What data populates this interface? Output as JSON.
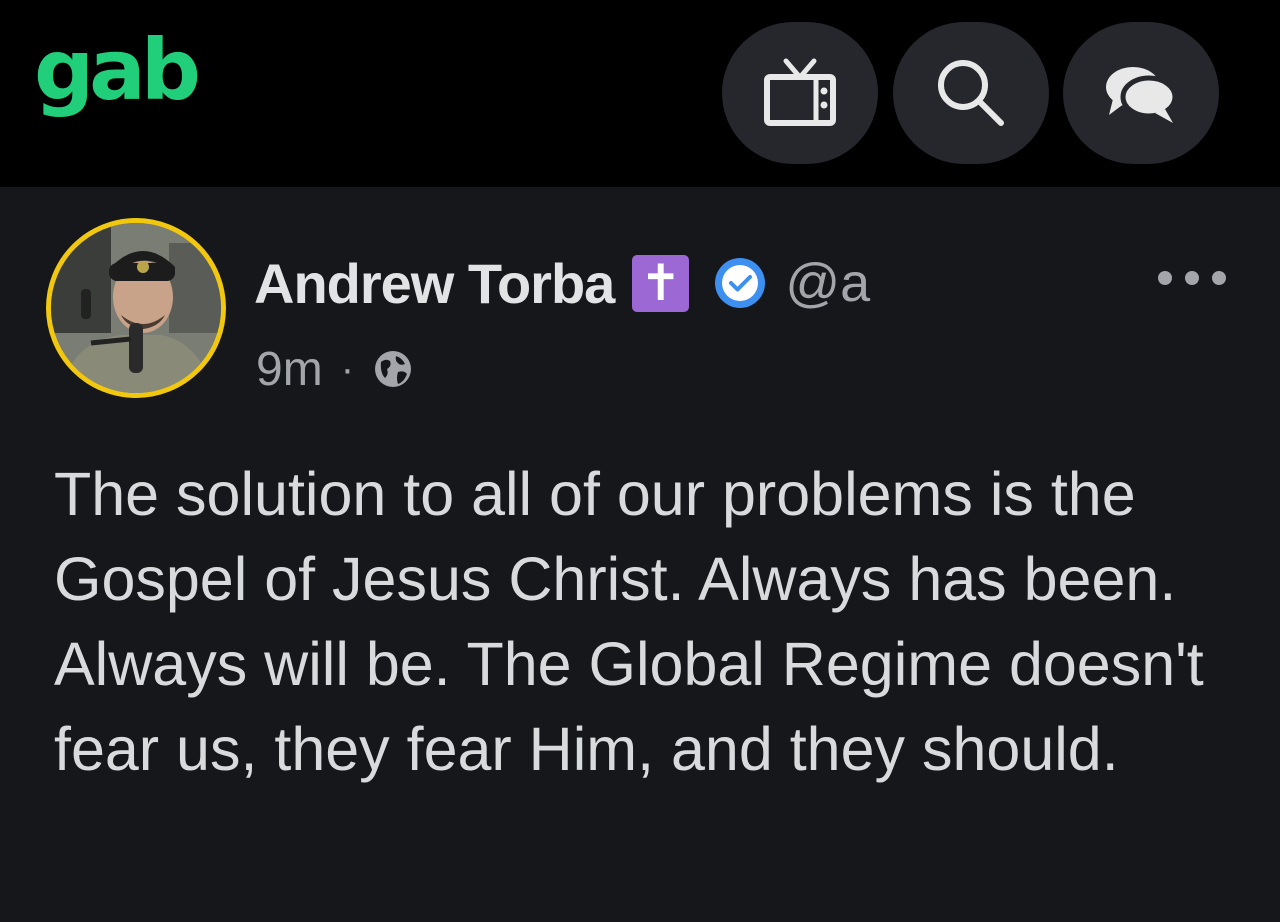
{
  "app": {
    "logo_text": "gab",
    "brand_color": "#21cf7a"
  },
  "header": {
    "buttons": [
      {
        "name": "tv",
        "icon": "tv-icon"
      },
      {
        "name": "search",
        "icon": "search-icon"
      },
      {
        "name": "chat",
        "icon": "chat-bubbles-icon"
      }
    ]
  },
  "post": {
    "author": {
      "name": "Andrew Torba",
      "badge_symbol": "✝",
      "badge_color": "#9b68d4",
      "verified": true,
      "verified_color": "#3d8ff0",
      "handle": "@a",
      "avatar_ring_color": "#f2c80f"
    },
    "timestamp": "9m",
    "separator": "·",
    "visibility_icon": "globe-icon",
    "menu_icon": "more-horizontal-icon",
    "body": "The solution to all of our problems is the Gospel of Jesus Christ. Always has been. Always will be. The Global Regime doesn't fear us, they fear Him, and they should."
  }
}
